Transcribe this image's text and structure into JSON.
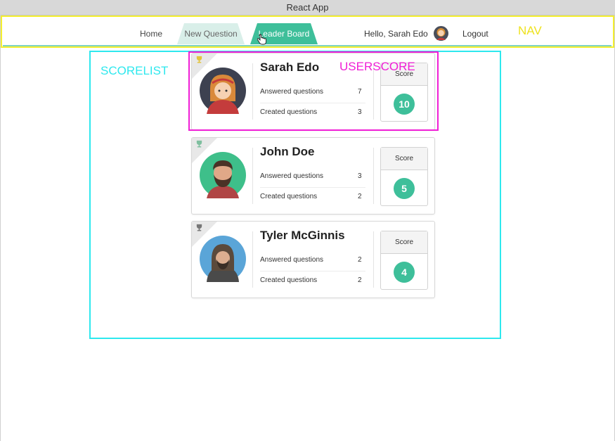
{
  "window": {
    "title": "React App"
  },
  "nav": {
    "annotation": "NAV",
    "home": "Home",
    "new_question": "New Question",
    "leader_board": "Leader Board",
    "greeting": "Hello, Sarah Edo",
    "logout": "Logout",
    "active_tab": "Leader Board"
  },
  "annotations": {
    "scorelist": "SCORELIST",
    "userscore": "USERSCORE"
  },
  "leaderboard": {
    "score_label": "Score",
    "answered_label": "Answered questions",
    "created_label": "Created questions",
    "users": [
      {
        "name": "Sarah Edo",
        "answered": "7",
        "created": "3",
        "score": "10"
      },
      {
        "name": "John Doe",
        "answered": "3",
        "created": "2",
        "score": "5"
      },
      {
        "name": "Tyler McGinnis",
        "answered": "2",
        "created": "2",
        "score": "4"
      }
    ]
  },
  "colors": {
    "accent": "#3ebf9a",
    "nav_box": "#f4ef2f",
    "scorelist_box": "#2ee8ee",
    "userscore_box": "#f01fd6"
  }
}
